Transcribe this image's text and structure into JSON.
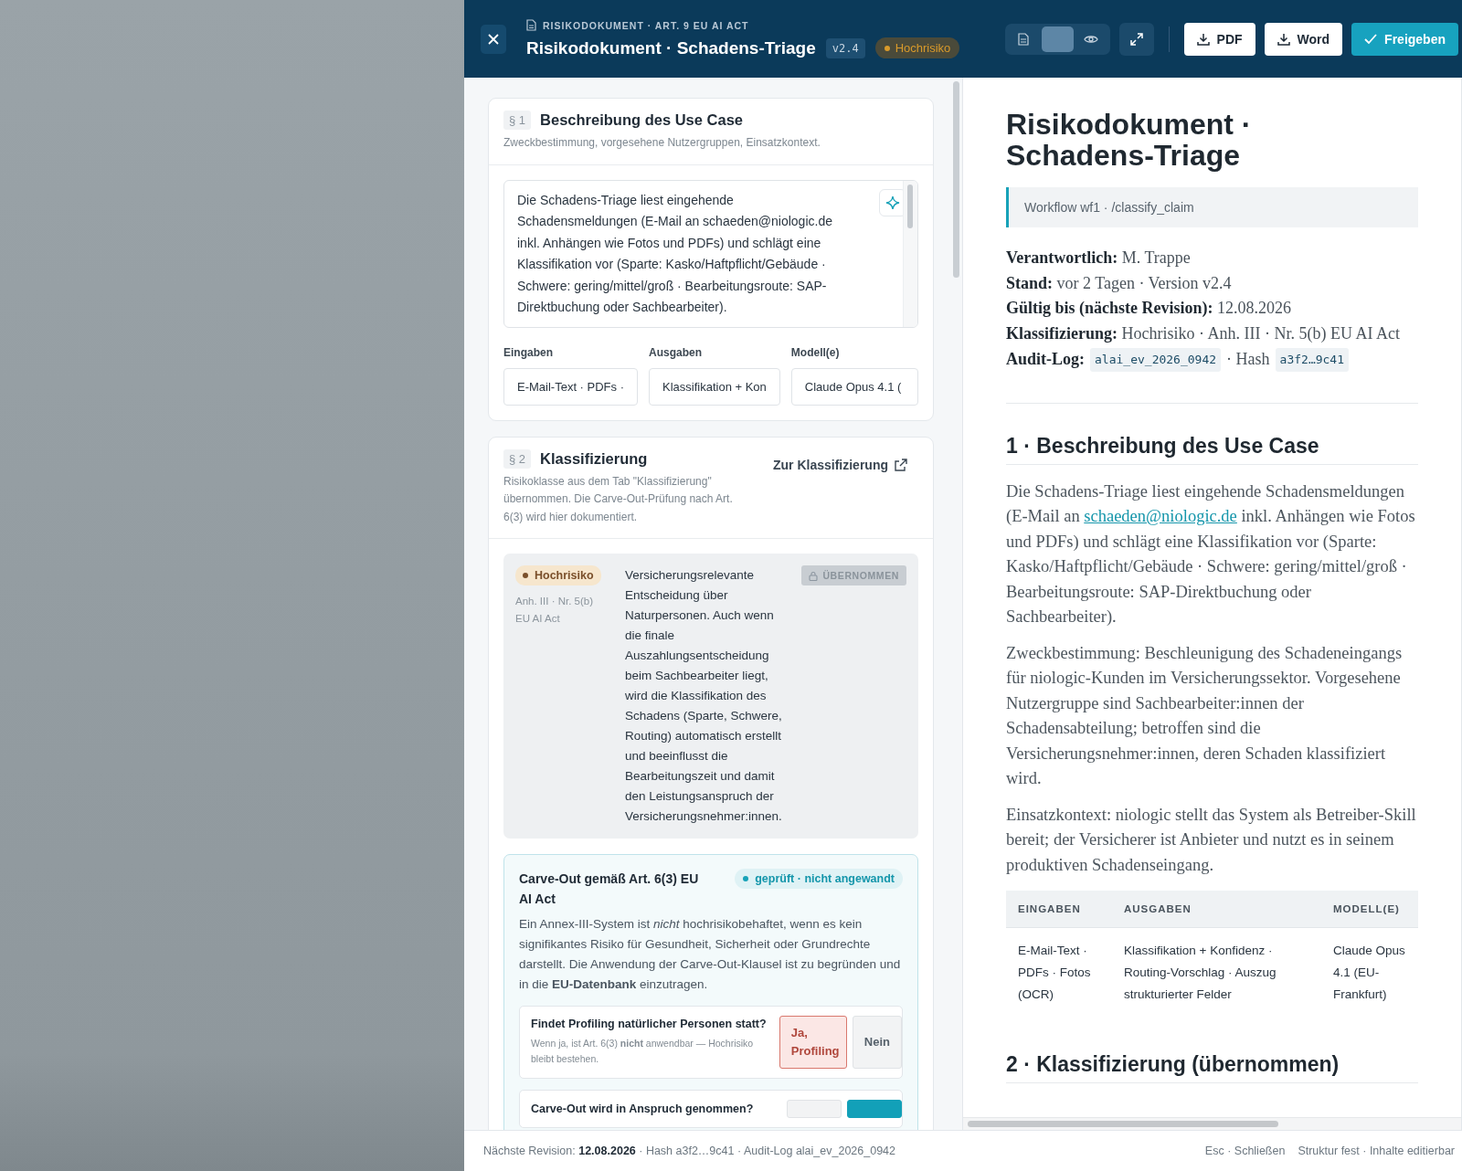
{
  "header": {
    "eyebrow": "RISIKODOKUMENT · ART. 9 EU AI ACT",
    "title": "Risikodokument · Schadens-Triage",
    "version": "v2.4",
    "risk_badge": "Hochrisiko",
    "view_toggle": [
      {
        "kind": "editor",
        "selected": false
      },
      {
        "kind": "split",
        "selected": true
      },
      {
        "kind": "preview",
        "selected": false
      }
    ],
    "buttons": [
      {
        "label": "PDF",
        "kind": "download"
      },
      {
        "label": "Word",
        "kind": "download"
      },
      {
        "label": "Freigeben",
        "kind": "primary"
      }
    ]
  },
  "section_1": {
    "number": "§ 1",
    "title": "Beschreibung des Use Case",
    "subtitle": "Zweckbestimmung, vorgesehene Nutzergruppen, Einsatzkontext.",
    "description": "Die Schadens-Triage liest eingehende Schadensmeldungen (E-Mail an schaeden@niologic.de inkl. Anhängen wie Fotos und PDFs) und schlägt eine Klassifikation vor (Sparte: Kasko/Haftpflicht/Gebäude · Schwere: gering/mittel/groß · Bearbeitungsroute: SAP-Direktbuchung oder Sachbearbeiter).",
    "fields": [
      {
        "label": "Eingaben",
        "value": "E-Mail-Text · PDFs ·"
      },
      {
        "label": "Ausgaben",
        "value": "Klassifikation + Kon"
      },
      {
        "label": "Modell(e)",
        "value": "Claude Opus 4.1 ("
      }
    ]
  },
  "section_2": {
    "number": "§ 2",
    "title": "Klassifizierung",
    "subtitle": "Risikoklasse aus dem Tab \"Klassifizierung\" übernommen. Die Carve-Out-Prüfung nach Art. 6(3) wird hier dokumentiert.",
    "link": "Zur Klassifizierung",
    "classification": {
      "badge": "Hochrisiko",
      "reference": "Anh. III · Nr. 5(b) EU AI Act",
      "text": "Versicherungsrelevante Entscheidung über Naturpersonen. Auch wenn die finale Auszahlungsentscheidung beim Sachbearbeiter liegt, wird die Klassifikation des Schadens (Sparte, Schwere, Routing) automatisch erstellt und beeinflusst die Bearbeitungszeit und damit den Leistungsanspruch der Versicherungsnehmer:innen.",
      "locked_label": "ÜBERNOMMEN"
    },
    "carve_out": {
      "title": "Carve-Out gemäß Art. 6(3) EU AI Act",
      "status": "geprüft · nicht angewandt",
      "text": "Ein Annex-III-System ist *nicht* hochrisikobehaftet, wenn es kein signifikantes Risiko für Gesundheit, Sicherheit oder Grundrechte darstellt. Die Anwendung der Carve-Out-Klausel ist zu begründen und in die **EU-Datenbank** einzutragen.",
      "questions": [
        {
          "question": "Findet Profiling natürlicher Personen statt?",
          "hint": "Wenn ja, ist Art. 6(3) **nicht** anwendbar — Hochrisiko bleibt bestehen.",
          "options": [
            {
              "label": "Ja, Profiling",
              "selected": true
            },
            {
              "label": "Nein",
              "selected": false
            }
          ]
        },
        {
          "question": "Carve-Out wird in Anspruch genommen?",
          "options": [
            {
              "selected": false
            },
            {
              "selected": true
            }
          ]
        }
      ]
    }
  },
  "preview": {
    "title": "Risikodokument · Schadens-Triage",
    "workflow": "Workflow wf1 · /classify_claim",
    "meta": [
      {
        "label": "Verantwortlich:",
        "value": "M. Trappe"
      },
      {
        "label": "Stand:",
        "value": "vor 2 Tagen · Version v2.4"
      },
      {
        "label": "Gültig bis (nächste Revision):",
        "value": "12.08.2026"
      },
      {
        "label": "Klassifizierung:",
        "value": "Hochrisiko · Anh. III · Nr. 5(b) EU AI Act"
      }
    ],
    "audit": {
      "label": "Audit-Log:",
      "log_id": "alai_ev_2026_0942",
      "hash_label": "· Hash",
      "hash": "a3f2…9c41"
    },
    "section_1_heading": "1 · Beschreibung des Use Case",
    "paragraph_1": {
      "before": "Die Schadens-Triage liest eingehende Schadensmeldungen (E-Mail an",
      "link": "schaeden@niologic.de",
      "after": "inkl. Anhängen wie Fotos und PDFs) und schlägt eine Klassifikation vor (Sparte: Kasko/Haftpflicht/Gebäude · Schwere: gering/mittel/groß · Bearbeitungsroute: SAP-Direktbuchung oder Sachbearbeiter)."
    },
    "paragraphs": [
      "Zweckbestimmung: Beschleunigung des Schadeneingangs für niologic-Kunden im Versicherungssektor. Vorgesehene Nutzergruppe sind Sachbearbeiter:innen der Schadensabteilung; betroffen sind die Versicherungsnehmer:innen, deren Schaden klassifiziert wird.",
      "Einsatzkontext: niologic stellt das System als Betreiber-Skill bereit; der Versicherer ist Anbieter und nutzt es in seinem produktiven Schadenseingang."
    ],
    "table": {
      "columns": [
        "EINGABEN",
        "AUSGABEN",
        "MODELL(E)"
      ],
      "rows": [
        [
          "E-Mail-Text · PDFs · Fotos (OCR)",
          "Klassifikation + Konfidenz · Routing-Vorschlag · Auszug strukturierter Felder",
          "Claude Opus 4.1 (EU-Frankfurt)"
        ]
      ]
    },
    "section_2_heading": "2 · Klassifizierung (übernommen)"
  },
  "footer": {
    "info": "Nächste Revision: **12.08.2026** · Hash a3f2…9c41 · Audit-Log alai_ev_2026_0942",
    "hint_close": "Esc · Schließen",
    "hint_structure": "Struktur fest · Inhalte editierbar"
  }
}
